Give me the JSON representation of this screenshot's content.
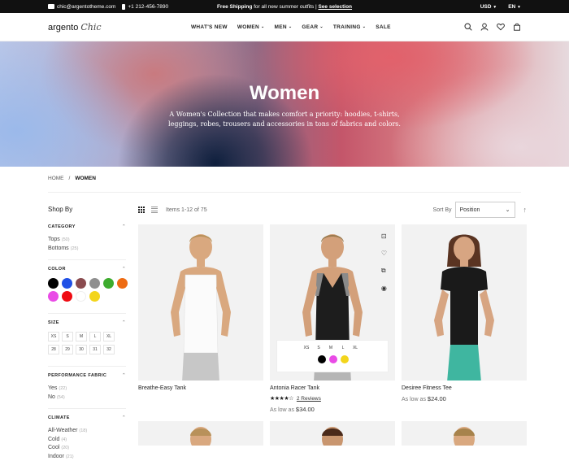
{
  "topbar": {
    "email": "chic@argentotheme.com",
    "phone": "+1 212-456-7890",
    "promo_bold": "Free Shipping",
    "promo_text": " for all new summer outfits | ",
    "promo_link": "See selection",
    "currency": "USD",
    "language": "EN"
  },
  "header": {
    "logo_main": "argento",
    "logo_script": "Chic",
    "nav": [
      "WHAT'S NEW",
      "WOMEN",
      "MEN",
      "GEAR",
      "TRAINING",
      "SALE"
    ]
  },
  "hero": {
    "title": "Women",
    "subtitle": "A Women's Collection that makes comfort a priority: hoodies, t-shirts, leggings, robes, trousers and accessories in tons of fabrics and colors."
  },
  "breadcrumb": {
    "home": "HOME",
    "sep": "/",
    "current": "WOMEN"
  },
  "sidebar": {
    "title": "Shop By",
    "category": {
      "label": "CATEGORY",
      "items": [
        {
          "name": "Tops",
          "count": "(50)"
        },
        {
          "name": "Bottoms",
          "count": "(25)"
        }
      ]
    },
    "color": {
      "label": "COLOR",
      "swatches": [
        "#000000",
        "#1f50e6",
        "#8a4b4f",
        "#8f8f8f",
        "#3eac2e",
        "#ee6b12",
        "#e94be6",
        "#ef0b12",
        "#ffffff",
        "#f3d51c"
      ]
    },
    "size": {
      "label": "SIZE",
      "sizes": [
        "XS",
        "S",
        "M",
        "L",
        "XL",
        "28",
        "29",
        "30",
        "31",
        "32"
      ]
    },
    "fabric": {
      "label": "PERFORMANCE FABRIC",
      "items": [
        {
          "name": "Yes",
          "count": "(22)"
        },
        {
          "name": "No",
          "count": "(54)"
        }
      ]
    },
    "climate": {
      "label": "CLIMATE",
      "items": [
        {
          "name": "All-Weather",
          "count": "(18)"
        },
        {
          "name": "Cold",
          "count": "(4)"
        },
        {
          "name": "Cool",
          "count": "(20)"
        },
        {
          "name": "Indoor",
          "count": "(21)"
        }
      ]
    }
  },
  "toolbar": {
    "items_text": "Items 1-12 of 75",
    "sort_label": "Sort By",
    "sort_value": "Position"
  },
  "products": [
    {
      "name": "Breathe-Easy Tank"
    },
    {
      "name": "Antonia Racer Tank",
      "stars": "★★★★☆",
      "reviews": "2  Reviews",
      "price_prefix": "As low as ",
      "price": "$34.00",
      "sizes": [
        "XS",
        "S",
        "M",
        "L",
        "XL"
      ],
      "colors": [
        "#000000",
        "#e94be6",
        "#f3d51c"
      ]
    },
    {
      "name": "Desiree Fitness Tee",
      "price_prefix": "As low as ",
      "price": "$24.00"
    }
  ]
}
